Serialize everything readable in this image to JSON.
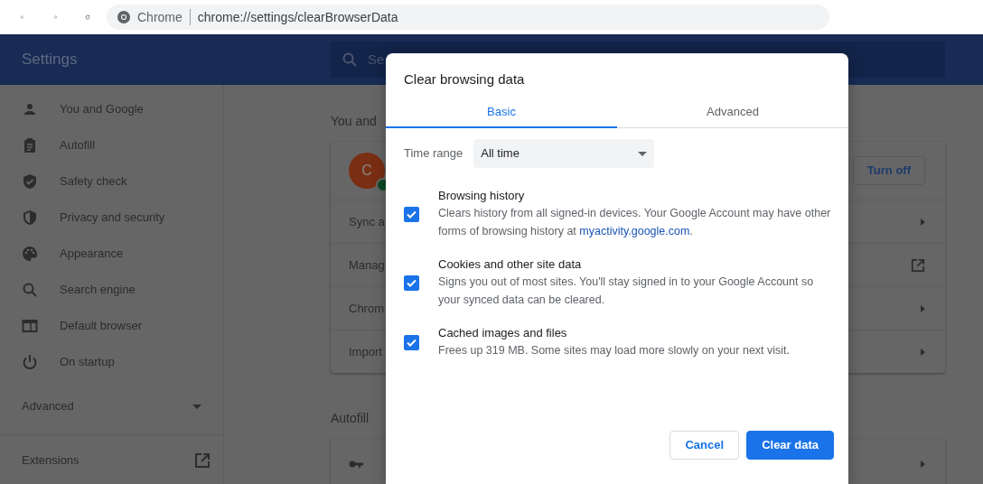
{
  "browser": {
    "site_label": "Chrome",
    "url": "chrome://settings/clearBrowserData"
  },
  "header": {
    "title": "Settings",
    "search_text": "Se"
  },
  "sidebar": {
    "items": [
      {
        "label": "You and Google"
      },
      {
        "label": "Autofill"
      },
      {
        "label": "Safety check"
      },
      {
        "label": "Privacy and security"
      },
      {
        "label": "Appearance"
      },
      {
        "label": "Search engine"
      },
      {
        "label": "Default browser"
      },
      {
        "label": "On startup"
      }
    ],
    "advanced": "Advanced",
    "extensions": "Extensions"
  },
  "main": {
    "section_title": "You and",
    "avatar_letter": "C",
    "turn_off": "Turn off",
    "rows": [
      {
        "label": "Sync a",
        "kind": "arrow"
      },
      {
        "label": "Manag",
        "kind": "external"
      },
      {
        "label": "Chrom",
        "kind": "arrow"
      },
      {
        "label": "Import",
        "kind": "arrow"
      }
    ],
    "autofill_title": "Autofill"
  },
  "dialog": {
    "title": "Clear browsing data",
    "tabs": [
      {
        "label": "Basic",
        "selected": true
      },
      {
        "label": "Advanced",
        "selected": false
      }
    ],
    "time_range_label": "Time range",
    "time_range_value": "All time",
    "options": [
      {
        "title": "Browsing history",
        "description": "Clears history from all signed-in devices. Your Google Account may have other forms of browsing history at ",
        "link": "myactivity.google.com",
        "after_link": ".",
        "checked": true
      },
      {
        "title": "Cookies and other site data",
        "description": "Signs you out of most sites. You'll stay signed in to your Google Account so your synced data can be cleared.",
        "checked": true
      },
      {
        "title": "Cached images and files",
        "description": "Frees up 319 MB. Some sites may load more slowly on your next visit.",
        "checked": true
      }
    ],
    "buttons": [
      {
        "label": "Cancel",
        "kind": "secondary"
      },
      {
        "label": "Clear data",
        "kind": "primary"
      }
    ]
  }
}
